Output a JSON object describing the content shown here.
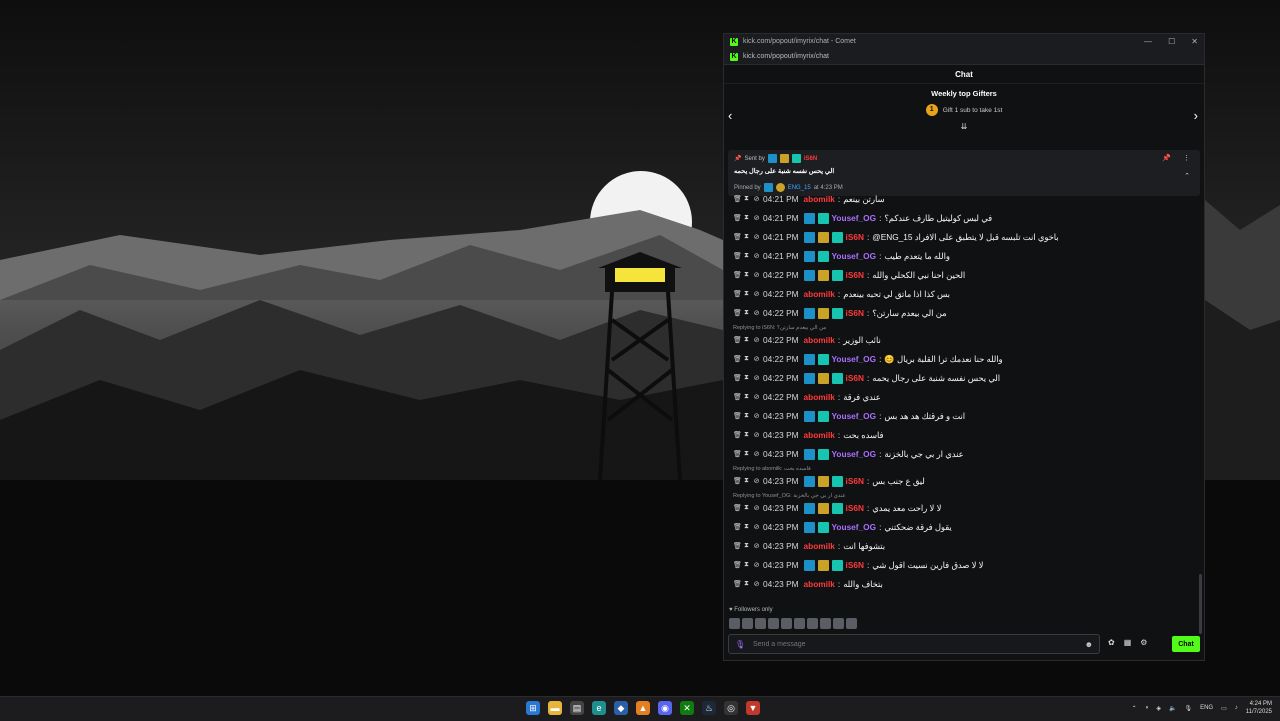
{
  "window": {
    "title": "kick.com/popout/imyrix/chat - Comet",
    "url": "kick.com/popout/imyrix/chat",
    "controls": [
      "—",
      "☐",
      "✕"
    ]
  },
  "chat": {
    "header": "Chat",
    "gifters_title": "Weekly top Gifters",
    "gifters_rank": "1",
    "gifters_text": "Gift 1 sub to take 1st"
  },
  "pinned": {
    "sent_by_label": "Sent by",
    "sent_by_user": "iS6N",
    "text": "الي يحس نفسه شنبة على رجال يحمه",
    "pinned_by_label": "Pinned by",
    "pinned_by_user": "ENG_15",
    "pinned_time": "at 4:23 PM"
  },
  "messages": [
    {
      "time": "04:21 PM",
      "user": "abomilk",
      "color": "#ff3b3b",
      "badges": [],
      "text": "سارتن بينعم"
    },
    {
      "time": "04:21 PM",
      "user": "Yousef_OG",
      "color": "#a970ff",
      "badges": [
        "blue",
        "teal"
      ],
      "text": "في لبس كوليتيل طارف عندكم؟"
    },
    {
      "time": "04:21 PM",
      "user": "iS6N",
      "color": "#ff3b3b",
      "badges": [
        "blue",
        "gold",
        "teal"
      ],
      "text": "@ENG_15 باخوي انت تلبسه قبل لا يتطبق على الافراد"
    },
    {
      "time": "04:21 PM",
      "user": "Yousef_OG",
      "color": "#a970ff",
      "badges": [
        "blue",
        "teal"
      ],
      "text": "والله ما يتعدم طيب"
    },
    {
      "time": "04:22 PM",
      "user": "iS6N",
      "color": "#ff3b3b",
      "badges": [
        "blue",
        "gold",
        "teal"
      ],
      "text": "الحين احنا نبي الكحلي والله"
    },
    {
      "time": "04:22 PM",
      "user": "abomilk",
      "color": "#ff3b3b",
      "badges": [],
      "text": "بس كذا اذا ماتق لي تحبه بينعدم"
    },
    {
      "time": "04:22 PM",
      "user": "iS6N",
      "color": "#ff3b3b",
      "badges": [
        "blue",
        "gold",
        "teal"
      ],
      "text": "من الي بيعدم سارتن؟"
    },
    {
      "time": "04:22 PM",
      "user": "abomilk",
      "color": "#ff3b3b",
      "badges": [],
      "text": "نائب الوزير",
      "reply": "Replying to iS6N: من الي بيعدم سارتن؟"
    },
    {
      "time": "04:22 PM",
      "user": "Yousef_OG",
      "color": "#a970ff",
      "badges": [
        "blue",
        "teal"
      ],
      "text": "😊 والله حنا نعدمك ترا القلبة بريال"
    },
    {
      "time": "04:22 PM",
      "user": "iS6N",
      "color": "#ff3b3b",
      "badges": [
        "blue",
        "gold",
        "teal"
      ],
      "text": "الي يحس نفسه شنبة على رجال يحمه"
    },
    {
      "time": "04:22 PM",
      "user": "abomilk",
      "color": "#ff3b3b",
      "badges": [],
      "text": "عندي فرقة"
    },
    {
      "time": "04:23 PM",
      "user": "Yousef_OG",
      "color": "#a970ff",
      "badges": [
        "blue",
        "teal"
      ],
      "text": "انت و فرقتك هد هد بس"
    },
    {
      "time": "04:23 PM",
      "user": "abomilk",
      "color": "#ff3b3b",
      "badges": [],
      "text": "فاسده بحت"
    },
    {
      "time": "04:23 PM",
      "user": "Yousef_OG",
      "color": "#a970ff",
      "badges": [
        "blue",
        "teal"
      ],
      "text": "عندي ار بي جي بالخزنة"
    },
    {
      "time": "04:23 PM",
      "user": "iS6N",
      "color": "#ff3b3b",
      "badges": [
        "blue",
        "gold",
        "teal"
      ],
      "text": "ليق ع جنب بس",
      "reply": "Replying to abomilk: فاسده بحت"
    },
    {
      "time": "04:23 PM",
      "user": "iS6N",
      "color": "#ff3b3b",
      "badges": [
        "blue",
        "gold",
        "teal"
      ],
      "text": "لا لا راحت معد يمدي",
      "reply": "Replying to Yousef_OG: عندي ار بي جي بالخزنة"
    },
    {
      "time": "04:23 PM",
      "user": "Yousef_OG",
      "color": "#a970ff",
      "badges": [
        "blue",
        "teal"
      ],
      "text": "يقول فرقة ضحكتني"
    },
    {
      "time": "04:23 PM",
      "user": "abomilk",
      "color": "#ff3b3b",
      "badges": [],
      "text": "بتشوفها انت"
    },
    {
      "time": "04:23 PM",
      "user": "iS6N",
      "color": "#ff3b3b",
      "badges": [
        "blue",
        "gold",
        "teal"
      ],
      "text": "لا لا صدق فارين نسيت اقول شي"
    },
    {
      "time": "04:23 PM",
      "user": "abomilk",
      "color": "#ff3b3b",
      "badges": [],
      "text": "بتخاف والله"
    }
  ],
  "footer": {
    "followers_only": "Followers only",
    "input_placeholder": "Send a message",
    "send_label": "Chat"
  },
  "taskbar": {
    "lang": "ENG",
    "time": "4:24 PM",
    "date": "11/7/2025"
  }
}
